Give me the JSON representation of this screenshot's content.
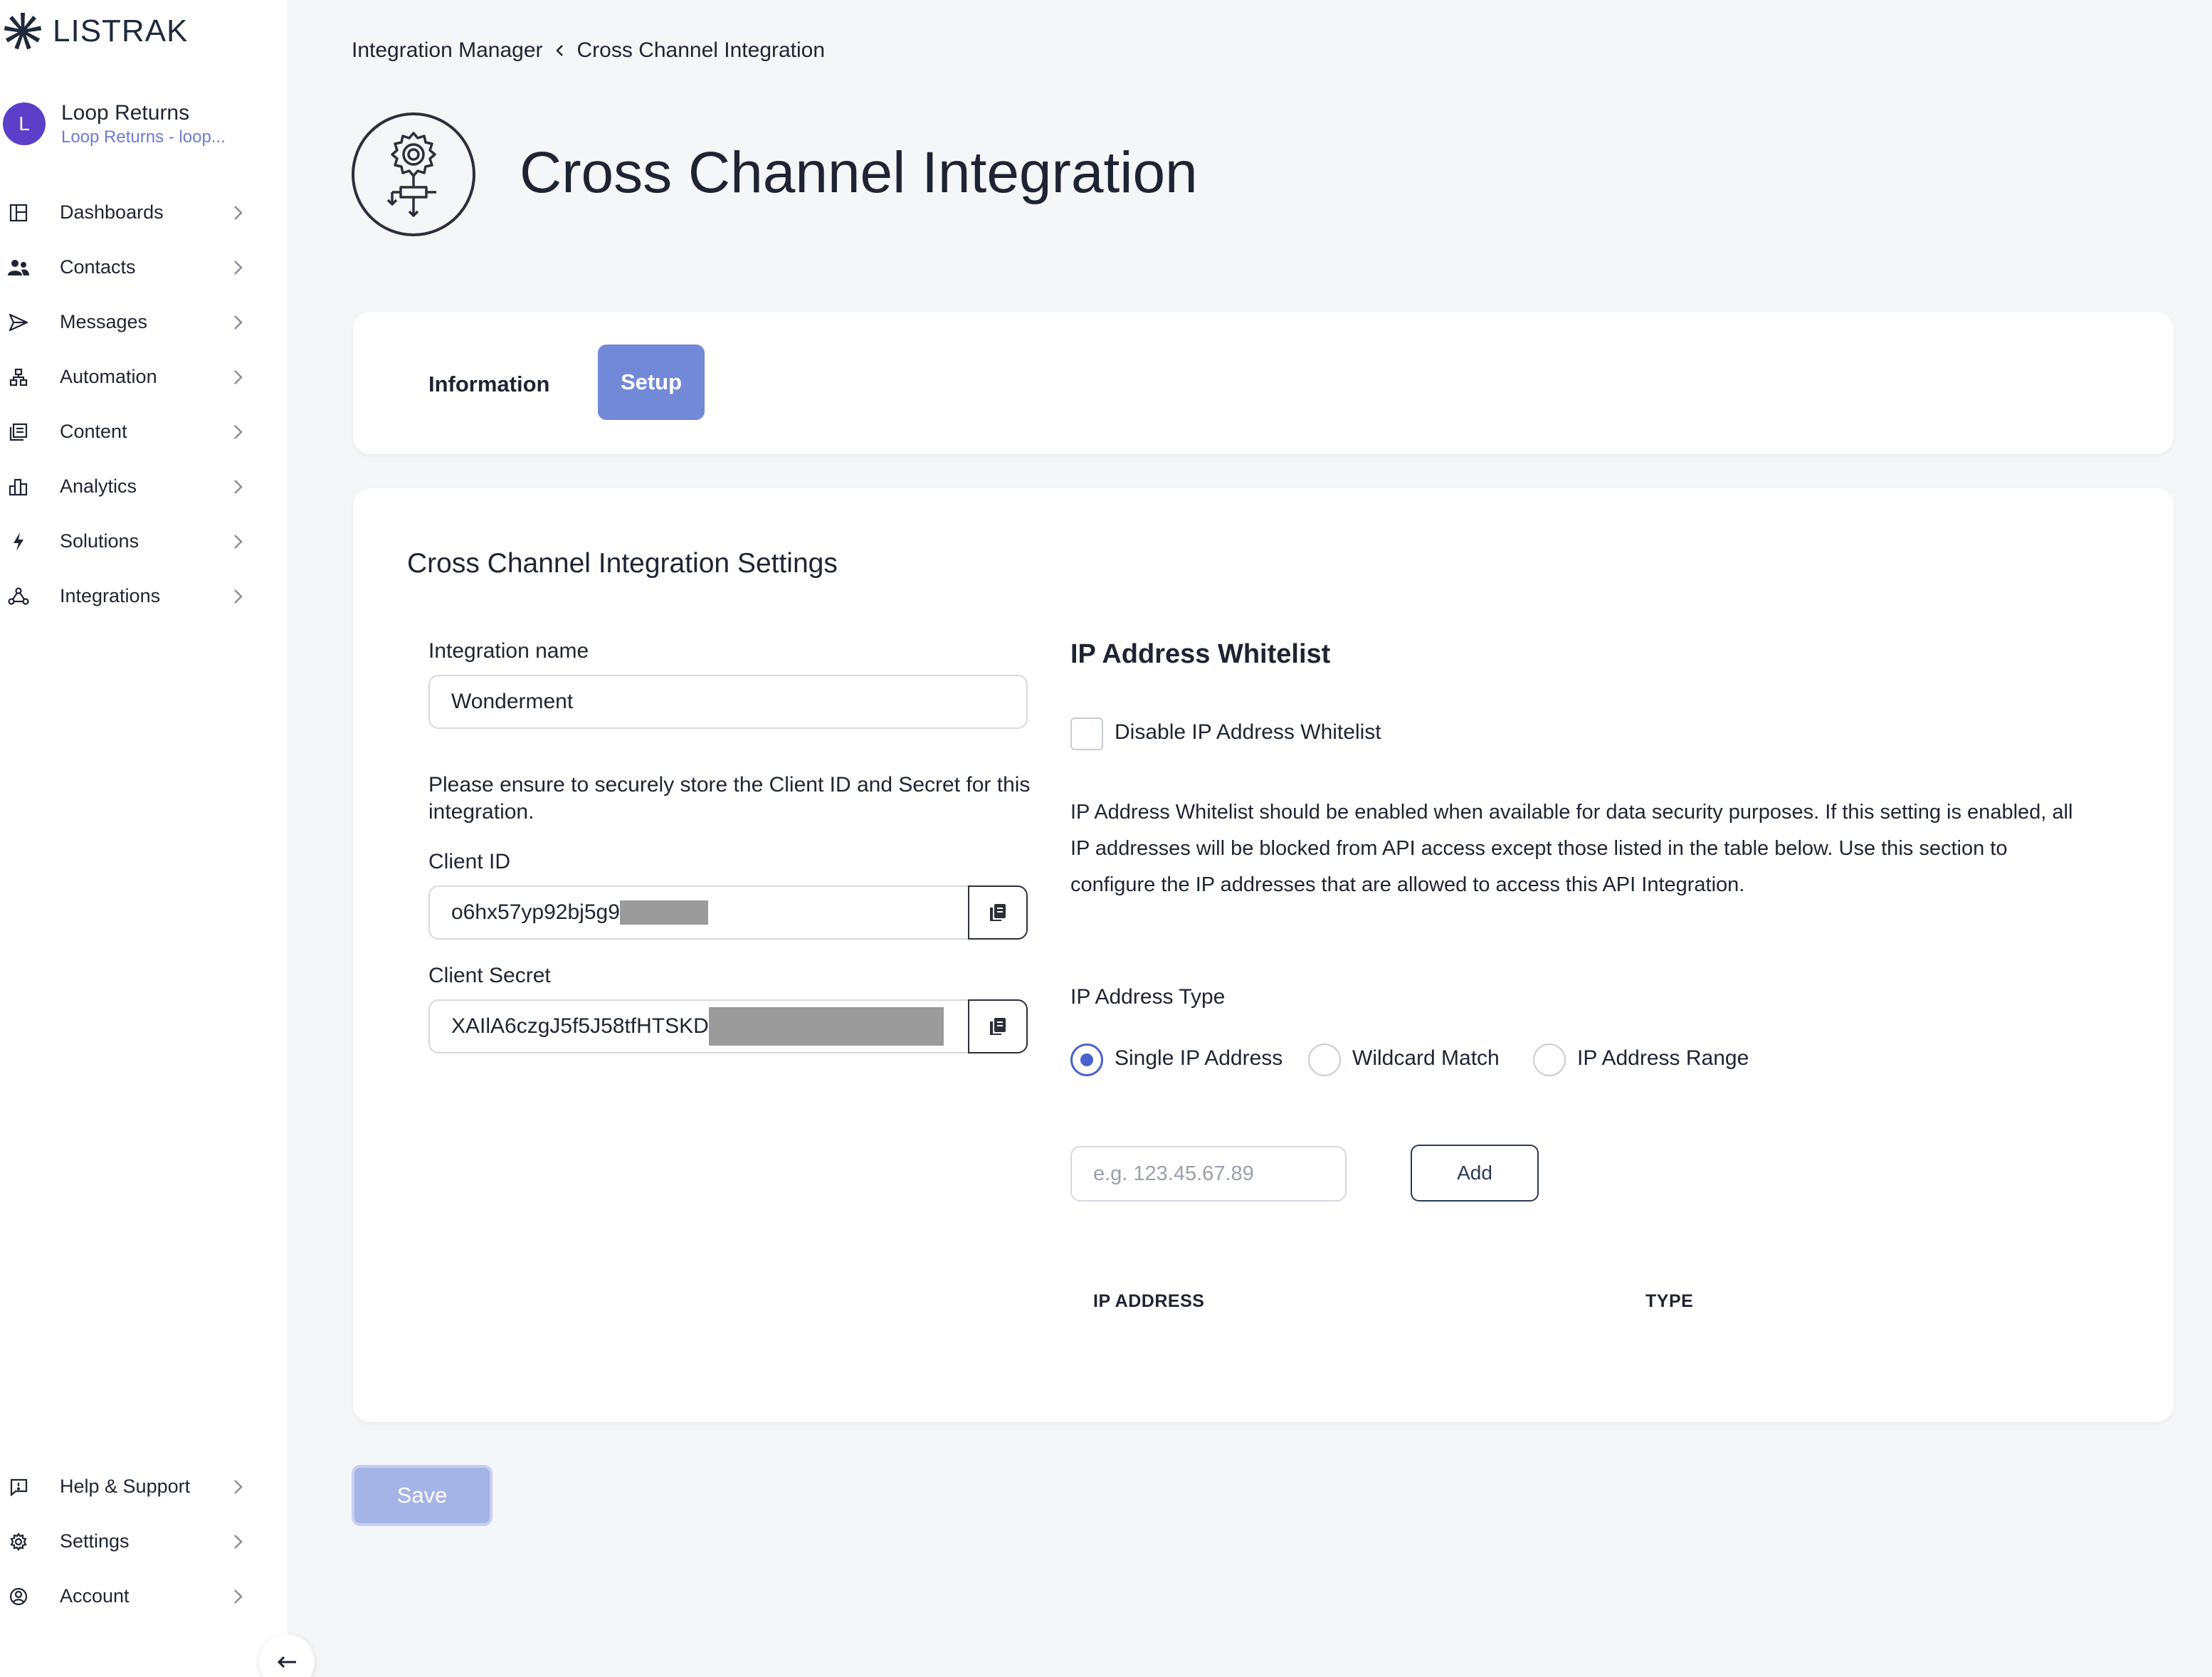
{
  "brand": {
    "name": "LISTRAK",
    "accent": "#7189d7",
    "avatar_color": "#5b3fc9"
  },
  "account": {
    "initial": "L",
    "name": "Loop Returns",
    "subtitle": "Loop Returns - loop..."
  },
  "sidebar": {
    "items": [
      {
        "label": "Dashboards",
        "icon": "dashboard-icon"
      },
      {
        "label": "Contacts",
        "icon": "contacts-icon"
      },
      {
        "label": "Messages",
        "icon": "send-icon"
      },
      {
        "label": "Automation",
        "icon": "automation-icon"
      },
      {
        "label": "Content",
        "icon": "content-icon"
      },
      {
        "label": "Analytics",
        "icon": "bar-chart-icon"
      },
      {
        "label": "Solutions",
        "icon": "lightning-icon"
      },
      {
        "label": "Integrations",
        "icon": "integrations-icon"
      }
    ],
    "bottom_items": [
      {
        "label": "Help & Support",
        "icon": "help-icon"
      },
      {
        "label": "Settings",
        "icon": "gear-icon"
      },
      {
        "label": "Account",
        "icon": "user-circle-icon"
      }
    ]
  },
  "breadcrumb": {
    "parent": "Integration Manager",
    "current": "Cross Channel Integration"
  },
  "page": {
    "title": "Cross Channel Integration"
  },
  "tabs": [
    {
      "label": "Information",
      "active": false
    },
    {
      "label": "Setup",
      "active": true
    }
  ],
  "settings": {
    "title": "Cross Channel Integration Settings",
    "integration_name_label": "Integration name",
    "integration_name_value": "Wonderment",
    "secure_note": "Please ensure to securely store the Client ID and Secret for this integration.",
    "client_id_label": "Client ID",
    "client_id_value": "o6hx57yp92bj5g9",
    "client_secret_label": "Client Secret",
    "client_secret_value": "XAIlA6czgJ5f5J58tfHTSKD"
  },
  "whitelist": {
    "title": "IP Address Whitelist",
    "disable_label": "Disable IP Address Whitelist",
    "description": "IP Address Whitelist should be enabled when available for data security purposes. If this setting is enabled, all IP addresses will be blocked from API access except those listed in the table below. Use this section to configure the IP addresses that are allowed to access this API Integration.",
    "type_label": "IP Address Type",
    "types": [
      {
        "label": "Single IP Address",
        "selected": true
      },
      {
        "label": "Wildcard Match",
        "selected": false
      },
      {
        "label": "IP Address Range",
        "selected": false
      }
    ],
    "ip_placeholder": "e.g. 123.45.67.89",
    "add_label": "Add",
    "columns": [
      "IP ADDRESS",
      "TYPE"
    ]
  },
  "save_label": "Save"
}
